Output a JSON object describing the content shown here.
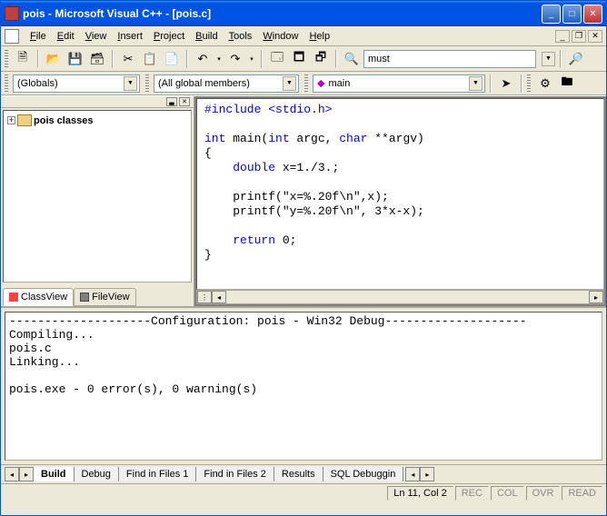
{
  "title": "pois - Microsoft Visual C++ - [pois.c]",
  "menu": [
    "File",
    "Edit",
    "View",
    "Insert",
    "Project",
    "Build",
    "Tools",
    "Window",
    "Help"
  ],
  "menu_accel": [
    "F",
    "E",
    "V",
    "I",
    "P",
    "B",
    "T",
    "W",
    "H"
  ],
  "find_value": "must",
  "combo_scope": "(Globals)",
  "combo_members": "(All global members)",
  "combo_func": "main",
  "tree_root": "pois classes",
  "left_tabs": {
    "classview": "ClassView",
    "fileview": "FileView"
  },
  "code_lines": [
    {
      "t": "pp",
      "s": "#include <stdio.h>"
    },
    {
      "t": "",
      "s": ""
    },
    {
      "t": "sig",
      "s": "int main(int argc, char **argv)"
    },
    {
      "t": "",
      "s": "{"
    },
    {
      "t": "decl",
      "s": "    double x=1./3.;"
    },
    {
      "t": "",
      "s": ""
    },
    {
      "t": "",
      "s": "    printf(\"x=%.20f\\n\",x);"
    },
    {
      "t": "",
      "s": "    printf(\"y=%.20f\\n\", 3*x-x);"
    },
    {
      "t": "",
      "s": ""
    },
    {
      "t": "ret",
      "s": "    return 0;"
    },
    {
      "t": "",
      "s": "}"
    }
  ],
  "output": "--------------------Configuration: pois - Win32 Debug--------------------\nCompiling...\npois.c\nLinking...\n\npois.exe - 0 error(s), 0 warning(s)",
  "output_tabs": [
    "Build",
    "Debug",
    "Find in Files 1",
    "Find in Files 2",
    "Results",
    "SQL Debuggin"
  ],
  "status": {
    "pos": "Ln 11, Col 2",
    "rec": "REC",
    "col": "COL",
    "ovr": "OVR",
    "read": "READ"
  }
}
